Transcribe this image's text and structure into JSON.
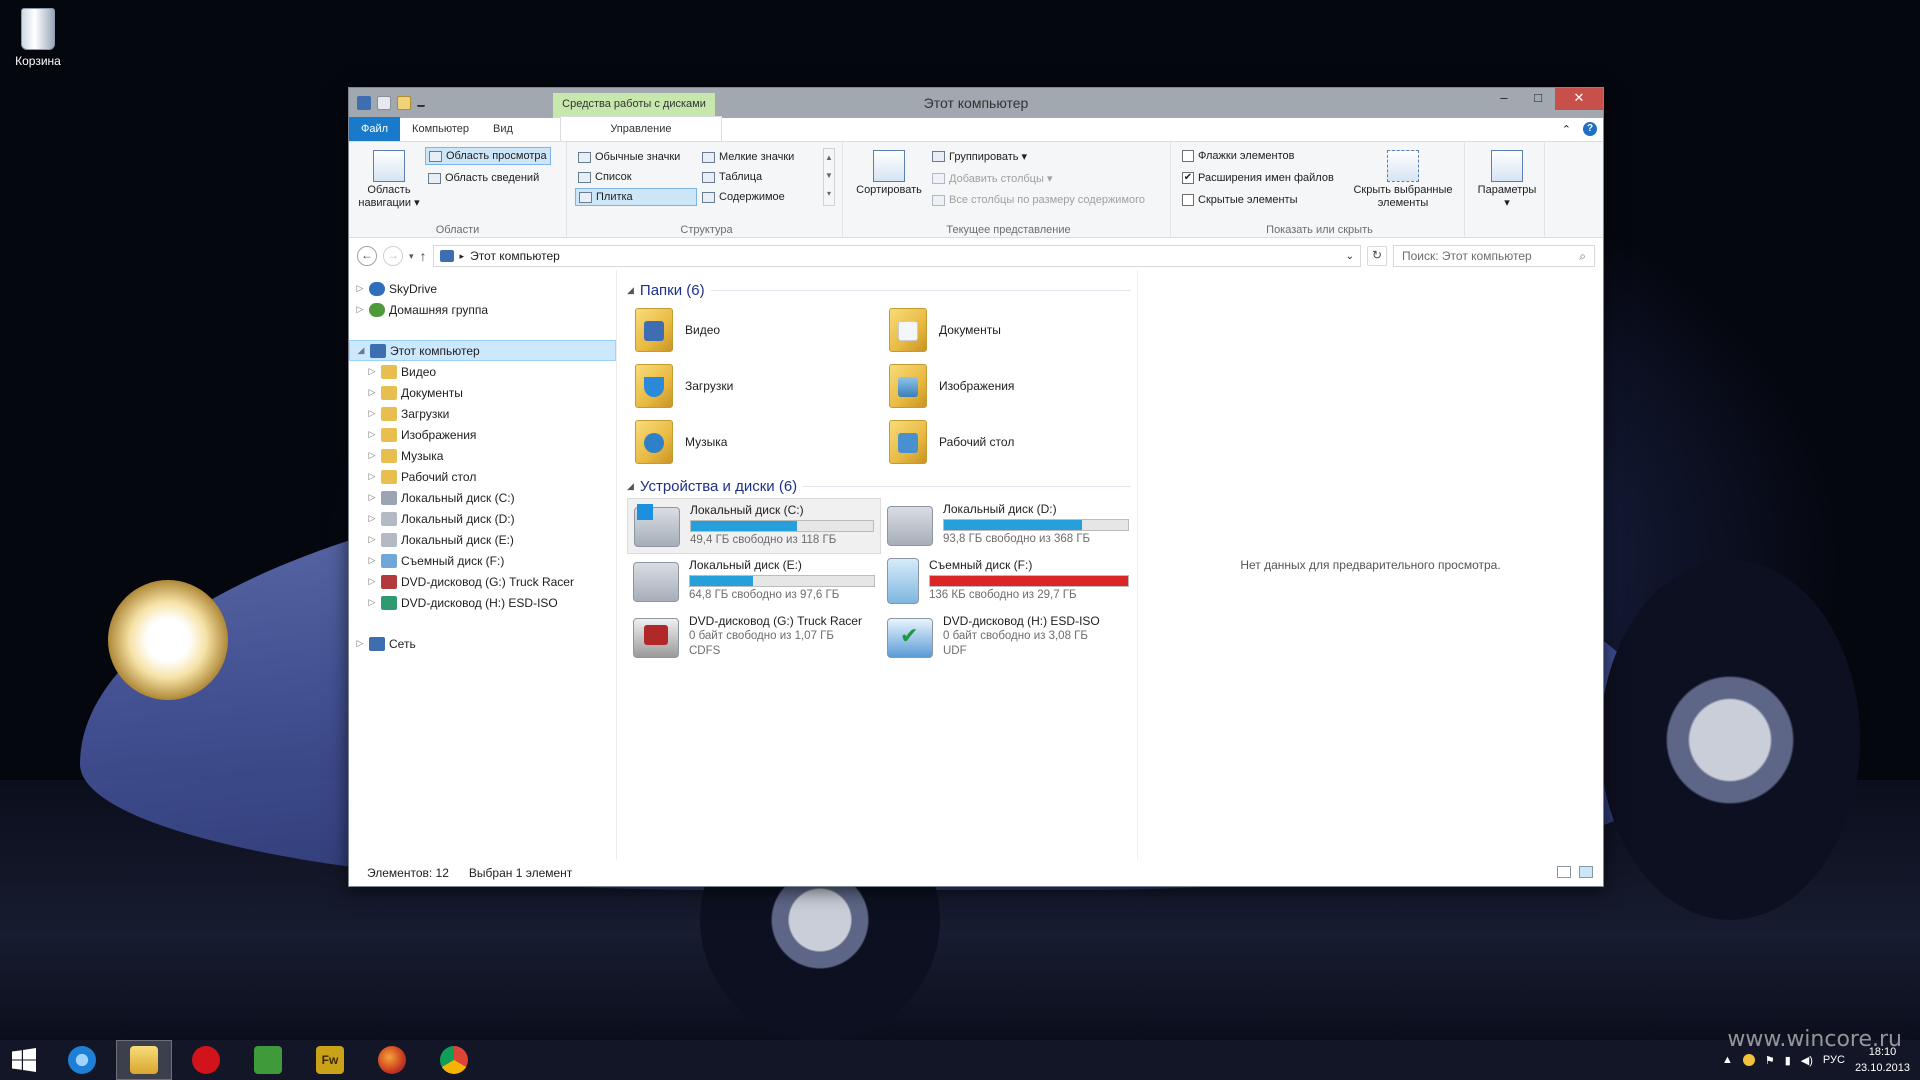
{
  "desktop": {
    "recycle_bin": "Корзина"
  },
  "window": {
    "title": "Этот компьютер",
    "context_tab_group": "Средства работы с дисками",
    "controls": {
      "minimize": "–",
      "maximize": "□",
      "close": "✕"
    }
  },
  "tabs": {
    "file": "Файл",
    "computer": "Компьютер",
    "view": "Вид",
    "manage": "Управление"
  },
  "ribbon": {
    "areas": {
      "nav_pane_1": "Область",
      "nav_pane_2": "навигации ▾",
      "preview_pane": "Область просмотра",
      "details_pane": "Область сведений",
      "label": "Области"
    },
    "layout": {
      "medium_icons": "Обычные значки",
      "small_icons": "Мелкие значки",
      "list": "Список",
      "details": "Таблица",
      "tiles": "Плитка",
      "content": "Содержимое",
      "label": "Структура"
    },
    "current_view": {
      "sort": "Сортировать",
      "group_by": "Группировать ▾",
      "add_columns": "Добавить столбцы ▾",
      "size_columns": "Все столбцы по размеру содержимого",
      "label": "Текущее представление"
    },
    "show_hide": {
      "item_checkboxes": "Флажки элементов",
      "file_extensions": "Расширения имен файлов",
      "hidden_items": "Скрытые элементы",
      "hide_selected_1": "Скрыть выбранные",
      "hide_selected_2": "элементы",
      "label": "Показать или скрыть"
    },
    "options": "Параметры"
  },
  "address": {
    "path": "Этот компьютер",
    "search_placeholder": "Поиск: Этот компьютер"
  },
  "nav": {
    "skydrive": "SkyDrive",
    "homegroup": "Домашняя группа",
    "this_pc": "Этот компьютер",
    "items": [
      "Видео",
      "Документы",
      "Загрузки",
      "Изображения",
      "Музыка",
      "Рабочий стол",
      "Локальный диск (C:)",
      "Локальный диск (D:)",
      "Локальный диск (E:)",
      "Съемный диск (F:)",
      "DVD-дисковод (G:) Truck Racer",
      "DVD-дисковод (H:) ESD-ISO"
    ],
    "network": "Сеть"
  },
  "folders": {
    "header": "Папки (6)",
    "items": [
      "Видео",
      "Документы",
      "Загрузки",
      "Изображения",
      "Музыка",
      "Рабочий стол"
    ]
  },
  "devices": {
    "header": "Устройства и диски (6)",
    "items": [
      {
        "name": "Локальный диск (C:)",
        "free": "49,4 ГБ свободно из 118 ГБ",
        "used_fraction": 0.58
      },
      {
        "name": "Локальный диск (D:)",
        "free": "93,8 ГБ свободно из 368 ГБ",
        "used_fraction": 0.75
      },
      {
        "name": "Локальный диск (E:)",
        "free": "64,8 ГБ свободно из 97,6 ГБ",
        "used_fraction": 0.34
      },
      {
        "name": "Съемный диск (F:)",
        "free": "136 КБ свободно из 29,7 ГБ",
        "used_fraction": 1.0
      },
      {
        "name": "DVD-дисковод (G:) Truck Racer",
        "free": "0 байт свободно из 1,07 ГБ",
        "fs": "CDFS"
      },
      {
        "name": "DVD-дисковод (H:) ESD-ISO",
        "free": "0 байт свободно из 3,08 ГБ",
        "fs": "UDF"
      }
    ]
  },
  "preview": "Нет данных для предварительного просмотра.",
  "status": {
    "items": "Элементов: 12",
    "selected": "Выбран 1 элемент"
  },
  "tray": {
    "lang": "РУС",
    "time": "18:10",
    "date": "23.10.2013"
  },
  "watermark": "www.wincore.ru",
  "colors": {
    "accent": "#1979ca",
    "bar": "#26a0da",
    "bar_full": "#da2626",
    "context_tab": "#c7e8ad"
  }
}
